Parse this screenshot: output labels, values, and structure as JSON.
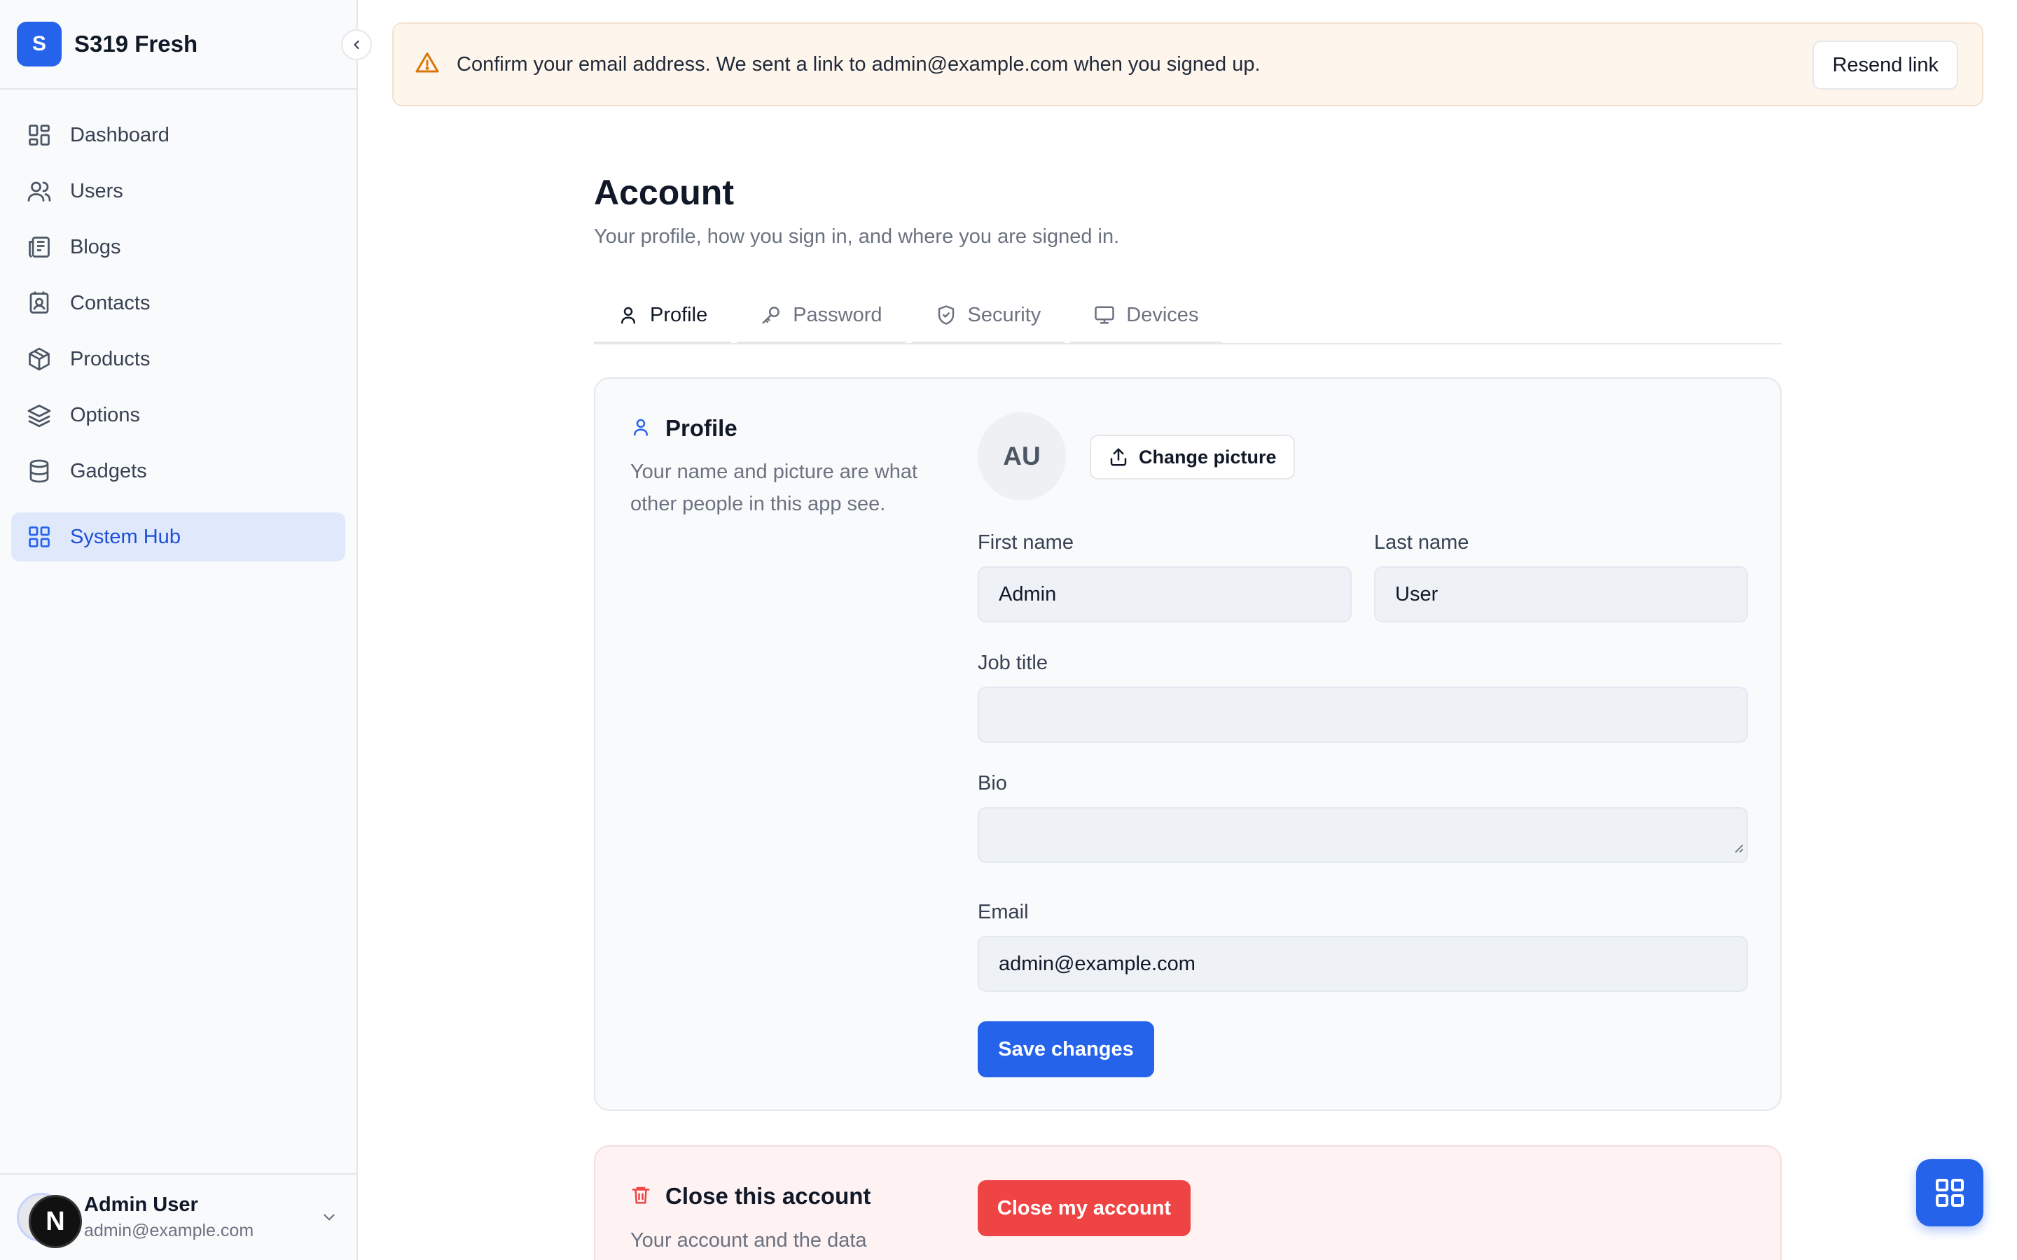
{
  "app": {
    "logo_letter": "S",
    "name": "S319 Fresh"
  },
  "sidebar": {
    "items": [
      {
        "label": "Dashboard",
        "icon": "dashboard-icon"
      },
      {
        "label": "Users",
        "icon": "users-icon"
      },
      {
        "label": "Blogs",
        "icon": "newspaper-icon"
      },
      {
        "label": "Contacts",
        "icon": "contact-card-icon"
      },
      {
        "label": "Products",
        "icon": "package-icon"
      },
      {
        "label": "Options",
        "icon": "layers-icon"
      },
      {
        "label": "Gadgets",
        "icon": "database-icon"
      }
    ],
    "active_item": {
      "label": "System Hub",
      "icon": "grid-icon"
    },
    "user": {
      "avatar_initials": "AU",
      "badge": "N",
      "name": "Admin User",
      "email": "admin@example.com"
    }
  },
  "banner": {
    "text": "Confirm your email address. We sent a link to admin@example.com when you signed up.",
    "button": "Resend link"
  },
  "page": {
    "title": "Account",
    "subtitle": "Your profile, how you sign in, and where you are signed in."
  },
  "tabs": [
    {
      "label": "Profile",
      "icon": "user-icon",
      "active": true
    },
    {
      "label": "Password",
      "icon": "key-icon",
      "active": false
    },
    {
      "label": "Security",
      "icon": "shield-icon",
      "active": false
    },
    {
      "label": "Devices",
      "icon": "monitor-icon",
      "active": false
    }
  ],
  "profile": {
    "title": "Profile",
    "description": "Your name and picture are what other people in this app see.",
    "avatar_initials": "AU",
    "change_picture": "Change picture",
    "first_name_label": "First name",
    "first_name_value": "Admin",
    "last_name_label": "Last name",
    "last_name_value": "User",
    "job_title_label": "Job title",
    "job_title_value": "",
    "bio_label": "Bio",
    "bio_value": "",
    "email_label": "Email",
    "email_value": "admin@example.com",
    "save_button": "Save changes"
  },
  "close_account": {
    "title": "Close this account",
    "description": "Your account and the data",
    "button": "Close my account"
  },
  "colors": {
    "accent": "#2563eb",
    "danger": "#ef4444",
    "warning": "#d97706"
  }
}
